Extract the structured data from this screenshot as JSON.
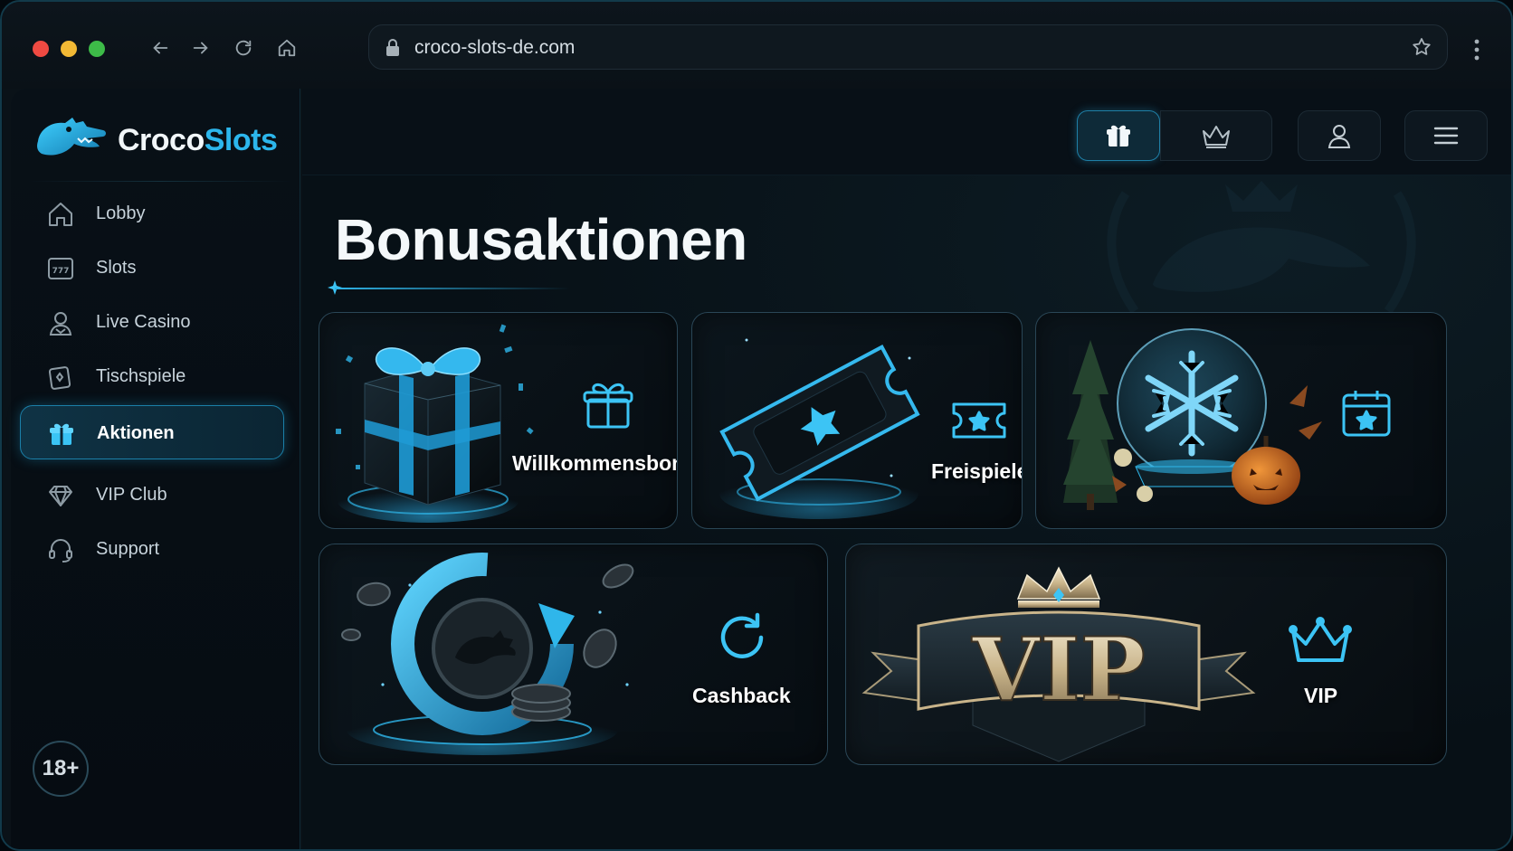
{
  "browser": {
    "url": "croco-slots-de.com"
  },
  "brand": {
    "name_part1": "Croco",
    "name_part2": "Slots"
  },
  "sidebar": {
    "items": [
      {
        "label": "Lobby",
        "icon": "home-icon",
        "active": false
      },
      {
        "label": "Slots",
        "icon": "slot-machine-icon",
        "active": false
      },
      {
        "label": "Live Casino",
        "icon": "dealer-icon",
        "active": false
      },
      {
        "label": "Tischspiele",
        "icon": "card-icon",
        "active": false
      },
      {
        "label": "Aktionen",
        "icon": "gift-icon",
        "active": true
      },
      {
        "label": "VIP Club",
        "icon": "diamond-icon",
        "active": false
      },
      {
        "label": "Support",
        "icon": "headset-icon",
        "active": false
      }
    ],
    "age_badge": "18+"
  },
  "topbar": {
    "buttons": [
      "gift-icon",
      "crown-icon",
      "user-icon",
      "menu-icon"
    ]
  },
  "main": {
    "title": "Bonusaktionen",
    "cards": [
      {
        "label": "Willkommensbonus",
        "icon": "gift-icon"
      },
      {
        "label": "Freispiele",
        "icon": "ticket-star-icon"
      },
      {
        "label": "",
        "icon": "calendar-star-icon"
      },
      {
        "label": "Cashback",
        "icon": "refresh-icon"
      },
      {
        "label": "VIP",
        "icon": "crown-icon",
        "banner_text": "VIP"
      }
    ]
  },
  "colors": {
    "accent": "#2cb6ec",
    "background": "#071016",
    "card_border": "#2a4656"
  }
}
